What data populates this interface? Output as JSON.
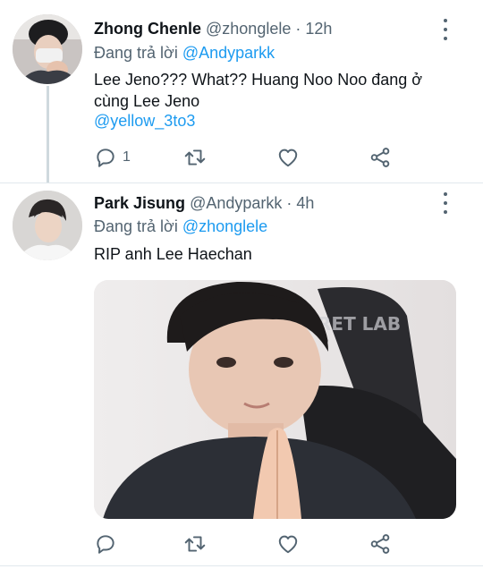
{
  "tweets": [
    {
      "display_name": "Zhong Chenle",
      "handle": "@zhonglele",
      "separator": "·",
      "time": "12h",
      "reply_prefix": "Đang trả lời",
      "reply_to": "@Andyparkk",
      "text": "Lee Jeno??? What?? Huang Noo Noo đang ở cùng Lee Jeno",
      "link": "@yellow_3to3",
      "reply_count": "1"
    },
    {
      "display_name": "Park Jisung",
      "handle": "@Andyparkk",
      "separator": "·",
      "time": "4h",
      "reply_prefix": "Đang trả lời",
      "reply_to": "@zhonglele",
      "text": "RIP anh Lee Haechan",
      "media_overlay_text": "RET LAB"
    }
  ],
  "icons": {
    "reply": "reply-icon",
    "retweet": "retweet-icon",
    "like": "heart-icon",
    "share": "share-icon",
    "more": "more-vertical-icon"
  },
  "colors": {
    "link": "#1d9bf0",
    "secondary_text": "#536471",
    "thread_line": "#cfd9de"
  }
}
